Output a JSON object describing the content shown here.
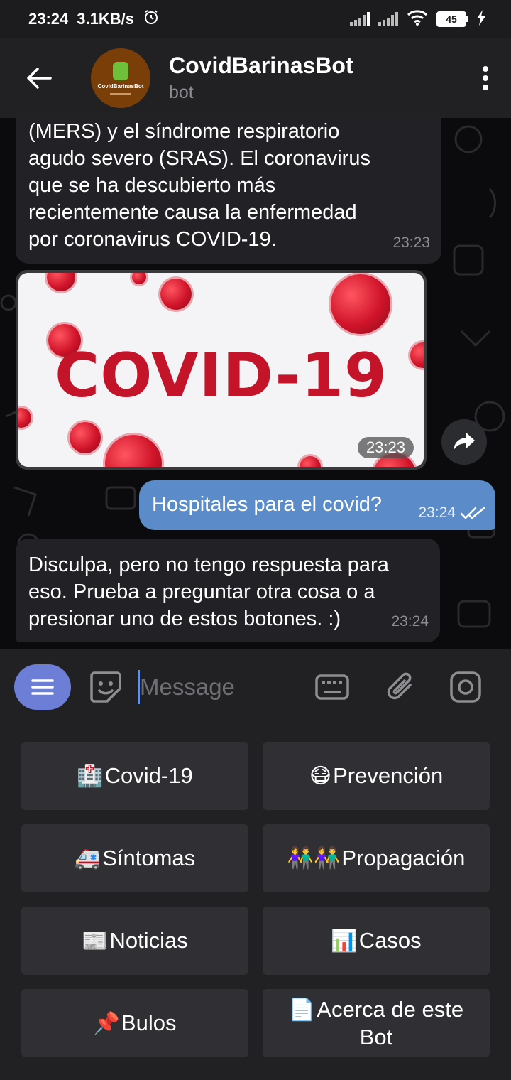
{
  "status_bar": {
    "time": "23:24",
    "net_speed": "3.1KB/s",
    "battery": "45"
  },
  "header": {
    "title": "CovidBarinasBot",
    "subtitle": "bot",
    "avatar_text": "CovidBarinasBot"
  },
  "messages": [
    {
      "type": "incoming",
      "text": "(MERS) y el síndrome respiratorio\nagudo severo (SRAS). El coronavirus\nque se ha descubierto más\nrecientemente causa la enfermedad\npor coronavirus COVID-19.",
      "time": "23:23"
    },
    {
      "type": "photo",
      "image_text": "COVID-19",
      "time": "23:23"
    },
    {
      "type": "outgoing",
      "text": "Hospitales para el covid?",
      "time": "23:24"
    },
    {
      "type": "incoming",
      "text": "Disculpa, pero no tengo respuesta para\neso. Prueba a preguntar otra cosa o a\npresionar uno de estos botones. :)",
      "time": "23:24"
    }
  ],
  "input": {
    "placeholder": "Message",
    "value": ""
  },
  "keyboard": {
    "buttons": [
      {
        "emoji": "🏥",
        "label": "Covid-19"
      },
      {
        "emoji": "😷",
        "label": "Prevención"
      },
      {
        "emoji": "🚑",
        "label": "Síntomas"
      },
      {
        "emoji": "👫👫",
        "label": "Propagación"
      },
      {
        "emoji": "📰",
        "label": "Noticias"
      },
      {
        "emoji": "📊",
        "label": "Casos"
      },
      {
        "emoji": "📌",
        "label": "Bulos"
      },
      {
        "emoji": "📄",
        "label": "Acerca de este Bot"
      }
    ]
  },
  "colors": {
    "accent": "#6c7ed6",
    "outgoing_bubble": "#5b8cc9",
    "incoming_bubble": "#222226",
    "panel": "#212124",
    "covid_red": "#c4142a"
  }
}
